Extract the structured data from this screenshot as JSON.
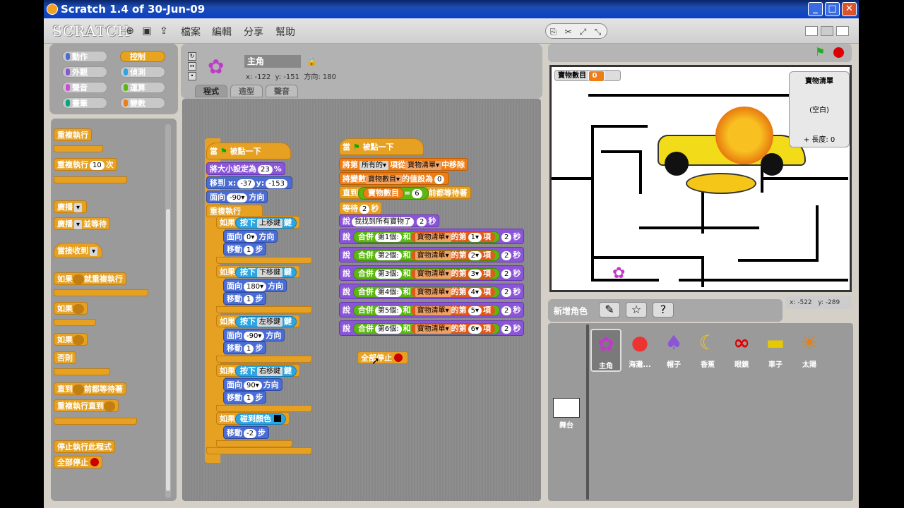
{
  "window": {
    "title": "Scratch 1.4 of 30-Jun-09"
  },
  "menubar": {
    "logo": "SCRATCH",
    "menus": [
      "檔案",
      "編輯",
      "分享",
      "幫助"
    ]
  },
  "categories": [
    {
      "label": "動作",
      "color": "#4a6cd4"
    },
    {
      "label": "控制",
      "color": "#e6a123",
      "selected": true
    },
    {
      "label": "外觀",
      "color": "#8a55d7"
    },
    {
      "label": "偵測",
      "color": "#2ca5e2"
    },
    {
      "label": "聲音",
      "color": "#cf4ad9"
    },
    {
      "label": "運算",
      "color": "#5cb712"
    },
    {
      "label": "畫筆",
      "color": "#00a87c"
    },
    {
      "label": "變數",
      "color": "#ee7d16"
    }
  ],
  "palette": {
    "forever": "重複執行",
    "repeat": "重複執行",
    "repeat_n": "10",
    "repeat_suffix": "次",
    "broadcast": "廣播",
    "broadcast_wait": "廣播",
    "broadcast_wait_suffix": "並等待",
    "when_receive": "當接收到",
    "forever_if": "如果",
    "forever_if_suffix": "就重複執行",
    "if": "如果",
    "ifelse": "如果",
    "else": "否則",
    "wait_until": "直到",
    "wait_until_suffix": "前都等待著",
    "repeat_until": "重複執行直到",
    "stop_script": "停止執行此程式",
    "stop_all": "全部停止"
  },
  "sprite": {
    "name": "主角",
    "x": "-122",
    "y": "-151",
    "dir_label": "方向:",
    "dir": "180",
    "xlabel": "x:",
    "ylabel": "y:"
  },
  "tabs": [
    "程式",
    "造型",
    "聲音"
  ],
  "script1": {
    "hat": "當",
    "hat_suffix": "被點一下",
    "size_pre": "將大小設定為",
    "size_val": "23",
    "size_suf": "%",
    "goto_pre": "移到 x:",
    "goto_x": "-37",
    "goto_y_label": "y:",
    "goto_y": "-153",
    "point_pre": "面向",
    "point_val": "-90▾",
    "point_suf": "方向",
    "forever": "重複執行",
    "ifs": [
      {
        "if": "如果",
        "key_pre": "按下",
        "key": "上移鍵",
        "key_suf": "鍵",
        "dir": "0▾",
        "move": "1"
      },
      {
        "if": "如果",
        "key_pre": "按下",
        "key": "下移鍵",
        "key_suf": "鍵",
        "dir": "180▾",
        "move": "1"
      },
      {
        "if": "如果",
        "key_pre": "按下",
        "key": "左移鍵",
        "key_suf": "鍵",
        "dir": "-90▾",
        "move": "1"
      },
      {
        "if": "如果",
        "key_pre": "按下",
        "key": "右移鍵",
        "key_suf": "鍵",
        "dir": "90▾",
        "move": "1"
      }
    ],
    "face": "面向",
    "face_suf": "方向",
    "move": "移動",
    "move_suf": "步",
    "touch_if": "如果",
    "touch": "碰到顏色",
    "touch_move": "-2"
  },
  "script2": {
    "hat": "當",
    "hat_suffix": "被點一下",
    "del_pre": "將第",
    "del_all": "所有的▾",
    "del_mid": "項從",
    "del_list": "寶物清單▾",
    "del_suf": "中移除",
    "setvar_pre": "將變數",
    "setvar_var": "寶物數目▾",
    "setvar_mid": "的值設為",
    "setvar_val": "0",
    "until_pre": "直到",
    "until_var": "寶物數目",
    "until_eq": "=",
    "until_val": "6",
    "until_suf": "前都等待著",
    "wait_pre": "等待",
    "wait_val": "2",
    "wait_suf": "秒",
    "say_pre": "說",
    "say_text": "我找到所有寶物了",
    "say_secs": "2",
    "say_suf": "秒",
    "says": [
      {
        "item": "第1個:",
        "idx": "1▾"
      },
      {
        "item": "第2個:",
        "idx": "2▾"
      },
      {
        "item": "第3個:",
        "idx": "3▾"
      },
      {
        "item": "第4個:",
        "idx": "4▾"
      },
      {
        "item": "第5個:",
        "idx": "5▾"
      },
      {
        "item": "第6個:",
        "idx": "6▾"
      }
    ],
    "join": "合併",
    "and": "和",
    "list": "寶物清單▾",
    "of": "的第",
    "item_suf": "項",
    "secs": "2",
    "secs_suf": "秒"
  },
  "stopall": "全部停止",
  "stage": {
    "var_label": "寶物數目",
    "var_value": "0",
    "list_title": "寶物清單",
    "list_empty": "(空白)",
    "list_len": "長度: 0",
    "mouse_x": "x: -522",
    "mouse_y": "y: -289"
  },
  "sprite_panel": {
    "new_sprite": "新增角色",
    "sprites": [
      "主角",
      "海灘...",
      "帽子",
      "香蕉",
      "眼鏡",
      "車子",
      "太陽"
    ],
    "stage": "舞台"
  }
}
